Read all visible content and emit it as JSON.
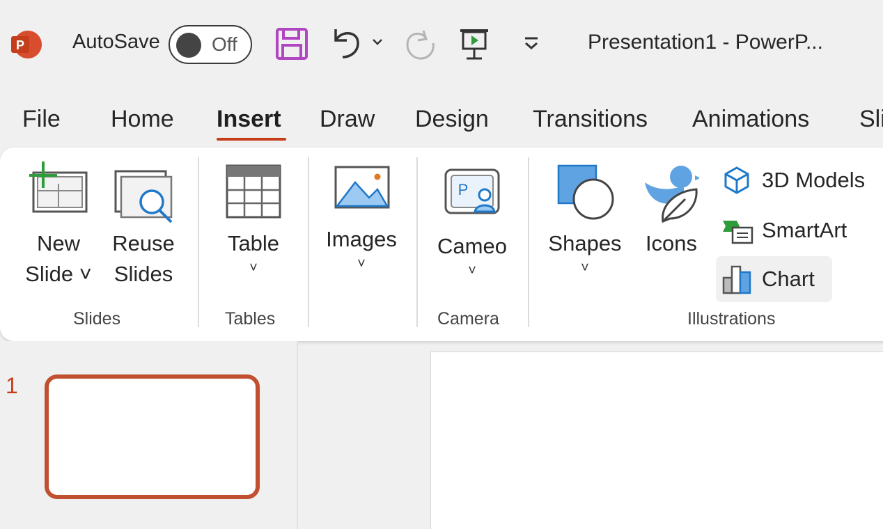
{
  "titlebar": {
    "autosave_label": "AutoSave",
    "autosave_state": "Off",
    "doc_title": "Presentation1  -  PowerP...",
    "app_logo_letter": "P"
  },
  "tabs": [
    {
      "label": "File"
    },
    {
      "label": "Home"
    },
    {
      "label": "Insert",
      "active": true
    },
    {
      "label": "Draw"
    },
    {
      "label": "Design"
    },
    {
      "label": "Transitions"
    },
    {
      "label": "Animations"
    },
    {
      "label": "Sli"
    }
  ],
  "ribbon": {
    "slides": {
      "group_label": "Slides",
      "new_slide_line1": "New",
      "new_slide_line2": "Slide ˅",
      "reuse_line1": "Reuse",
      "reuse_line2": "Slides"
    },
    "tables": {
      "group_label": "Tables",
      "table_label": "Table"
    },
    "images": {
      "images_label": "Images"
    },
    "camera": {
      "group_label": "Camera",
      "cameo_label": "Cameo"
    },
    "illustrations": {
      "group_label": "Illustrations",
      "shapes_label": "Shapes",
      "icons_label": "Icons",
      "models_label": "3D Models",
      "smartart_label": "SmartArt",
      "chart_label": "Chart"
    },
    "chevron": "˅"
  },
  "thumbnails": {
    "slide_number": "1"
  },
  "colors": {
    "accent": "#c43e1c",
    "icon_blue": "#1f78c8",
    "icon_light_blue": "#9ccaf2",
    "save_purple": "#b146c2"
  }
}
